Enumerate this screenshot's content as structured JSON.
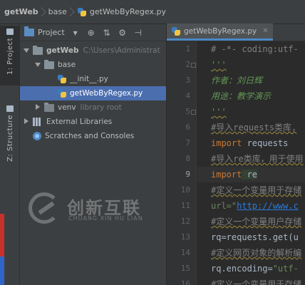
{
  "navbar": {
    "crumbs": [
      "getWeb",
      "base",
      "getWebByRegex.py"
    ]
  },
  "left_strip": {
    "project_tab": "1: Project",
    "structure_tab": "Z: Structure"
  },
  "project_panel": {
    "title": "Project",
    "tree": {
      "root_name": "getWeb",
      "root_path": "C:\\Users\\Administrat",
      "base": "base",
      "init_file": "__init__.py",
      "regex_file": "getWebByRegex.py",
      "venv": "venv",
      "venv_note": "library root",
      "external": "External Libraries",
      "scratches": "Scratches and Consoles"
    }
  },
  "watermark": {
    "cn": "创新互联",
    "en": "CHUANG XIN HU LIAN"
  },
  "editor": {
    "tab_label": "getWebByRegex.py",
    "current_line": 9,
    "line_numbers": [
      1,
      2,
      3,
      4,
      5,
      6,
      7,
      8,
      9,
      10,
      11,
      12,
      13,
      14,
      15,
      16
    ],
    "code": {
      "l1": "# -*- coding:utf-",
      "l2": "'''",
      "l3": "作者：刘日辉",
      "l4": "用途：教学演示",
      "l5": "'''",
      "l6": "#导入requests类库,",
      "l7_kw": "import",
      "l7_rest": " requests",
      "l8": "#导入re类库，用于使用",
      "l9_kw": "import",
      "l9_rest": " re",
      "l10": "#定义一个变量用于存储",
      "l11_pre": "url=\"",
      "l11_url": "http://www.c",
      "l12": "#定义一个变量用户存储",
      "l13": "rq=requests.get(u",
      "l14": "#定义网页对象的解析编",
      "l15_pre": "rq.encoding=",
      "l15_str": "\"utf-",
      "l16": "#定义一个变量用于存储"
    }
  }
}
